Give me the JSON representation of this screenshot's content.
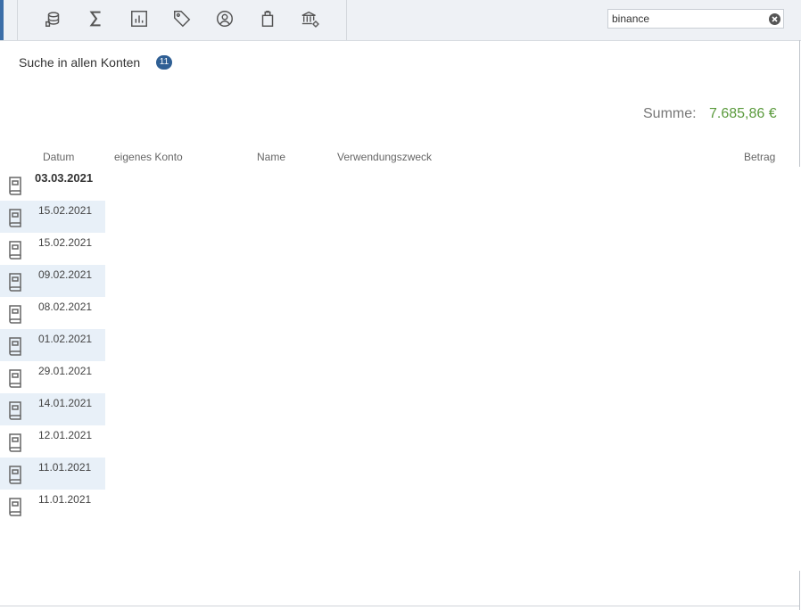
{
  "toolbar": {
    "icons": [
      "account-icon",
      "sum-icon",
      "chart-icon",
      "tag-icon",
      "person-icon",
      "clipboard-icon",
      "bank-settings-icon"
    ],
    "accent_color": "#3b6ea8"
  },
  "search": {
    "value": "binance",
    "placeholder": ""
  },
  "heading": {
    "title": "Suche in allen Konten",
    "count": "11"
  },
  "summary": {
    "label": "Summe:",
    "value": "7.685,86 €",
    "value_color": "#5a9a3c"
  },
  "columns": {
    "datum": "Datum",
    "eigenes_konto": "eigenes Konto",
    "name": "Name",
    "verwendungszweck": "Verwendungszweck",
    "betrag": "Betrag"
  },
  "rows": [
    {
      "date": "03.03.2021"
    },
    {
      "date": "15.02.2021"
    },
    {
      "date": "15.02.2021"
    },
    {
      "date": "09.02.2021"
    },
    {
      "date": "08.02.2021"
    },
    {
      "date": "01.02.2021"
    },
    {
      "date": "29.01.2021"
    },
    {
      "date": "14.01.2021"
    },
    {
      "date": "12.01.2021"
    },
    {
      "date": "11.01.2021"
    },
    {
      "date": "11.01.2021"
    }
  ]
}
